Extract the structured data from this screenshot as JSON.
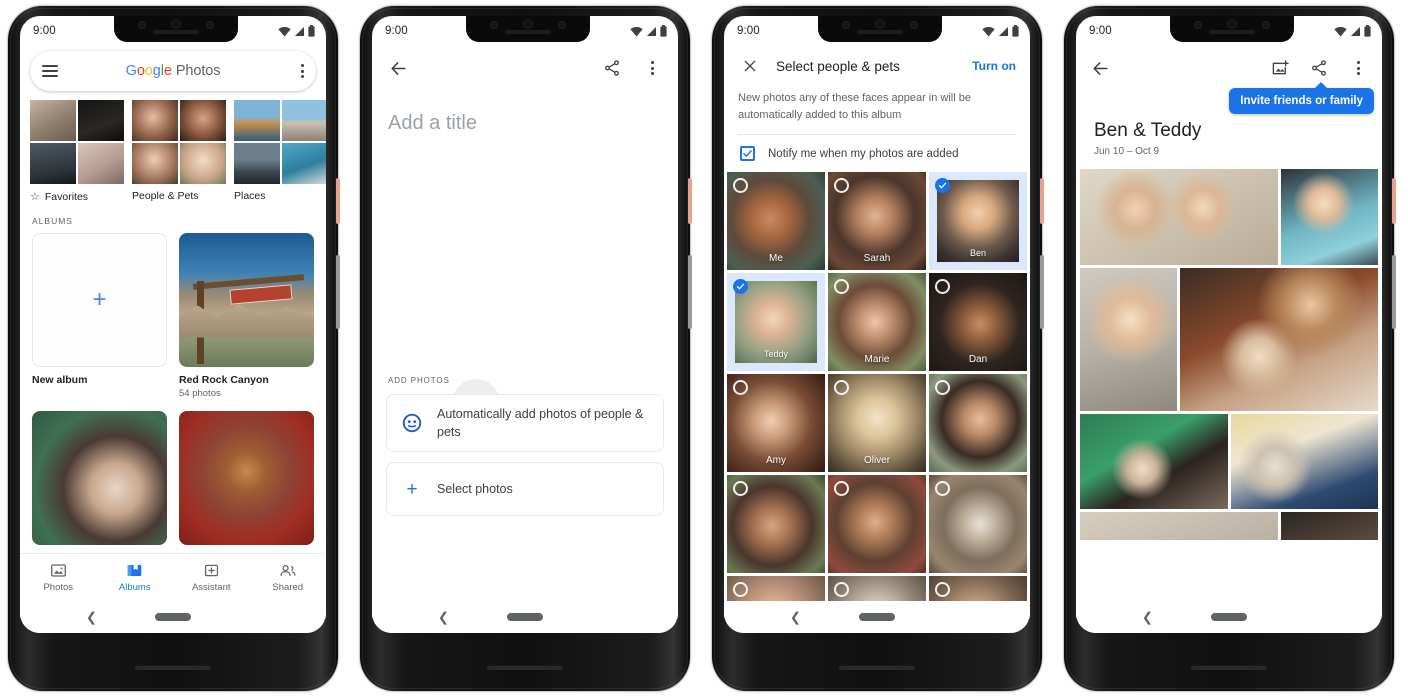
{
  "status_bar": {
    "time": "9:00",
    "icons": [
      "wifi-icon",
      "signal-icon",
      "battery-icon"
    ]
  },
  "phone1": {
    "name": "google-photos-albums-screen",
    "search_bar": {
      "menu_icon": "hamburger-menu-icon",
      "logo_google": "Google",
      "logo_photos": "Photos",
      "overflow_icon": "kebab-menu-icon"
    },
    "categories": [
      {
        "label": "Favorites",
        "icon": "star-icon"
      },
      {
        "label": "People & Pets",
        "icon": ""
      },
      {
        "label": "Places",
        "icon": ""
      }
    ],
    "section_label": "ALBUMS",
    "albums": [
      {
        "name": "New album",
        "count": "",
        "kind": "new"
      },
      {
        "name": "Red Rock Canyon",
        "count": "54 photos",
        "kind": "photo"
      }
    ],
    "bottom_nav": [
      {
        "label": "Photos",
        "icon": "photos-icon",
        "active": false
      },
      {
        "label": "Albums",
        "icon": "albums-icon",
        "active": true
      },
      {
        "label": "Assistant",
        "icon": "assistant-icon",
        "active": false
      },
      {
        "label": "Shared",
        "icon": "shared-icon",
        "active": false
      }
    ],
    "accent_color": "#1a73e8"
  },
  "phone2": {
    "name": "new-album-screen",
    "back_icon": "back-arrow-icon",
    "share_icon": "share-icon",
    "overflow_icon": "kebab-menu-icon",
    "title_placeholder": "Add a title",
    "section_label": "ADD PHOTOS",
    "actions": [
      {
        "label": "Automatically add photos of people & pets",
        "icon": "face-circle-icon"
      },
      {
        "label": "Select photos",
        "icon": "plus-icon"
      }
    ]
  },
  "phone3": {
    "name": "select-people-and-pets-screen",
    "close_icon": "close-icon",
    "title": "Select people & pets",
    "action_label": "Turn on",
    "description": "New photos any of these faces appear in will be automatically added to this album",
    "notify_label": "Notify me when my photos are added",
    "notify_checked": true,
    "faces": [
      {
        "name": "Me",
        "selected": false
      },
      {
        "name": "Sarah",
        "selected": false
      },
      {
        "name": "Ben",
        "selected": true
      },
      {
        "name": "Teddy",
        "selected": true
      },
      {
        "name": "Marie",
        "selected": false
      },
      {
        "name": "Dan",
        "selected": false
      },
      {
        "name": "Amy",
        "selected": false
      },
      {
        "name": "Oliver",
        "selected": false
      },
      {
        "name": "",
        "selected": false
      },
      {
        "name": "",
        "selected": false
      },
      {
        "name": "",
        "selected": false
      },
      {
        "name": "",
        "selected": false
      },
      {
        "name": "",
        "selected": false
      },
      {
        "name": "",
        "selected": false
      },
      {
        "name": "",
        "selected": false
      }
    ]
  },
  "phone4": {
    "name": "shared-album-screen",
    "back_icon": "back-arrow-icon",
    "add_photo_icon": "add-photo-icon",
    "share_icon": "share-icon",
    "overflow_icon": "kebab-menu-icon",
    "tooltip": "Invite friends or family",
    "album_title": "Ben & Teddy",
    "album_dates": "Jun 10 – Oct 9"
  }
}
